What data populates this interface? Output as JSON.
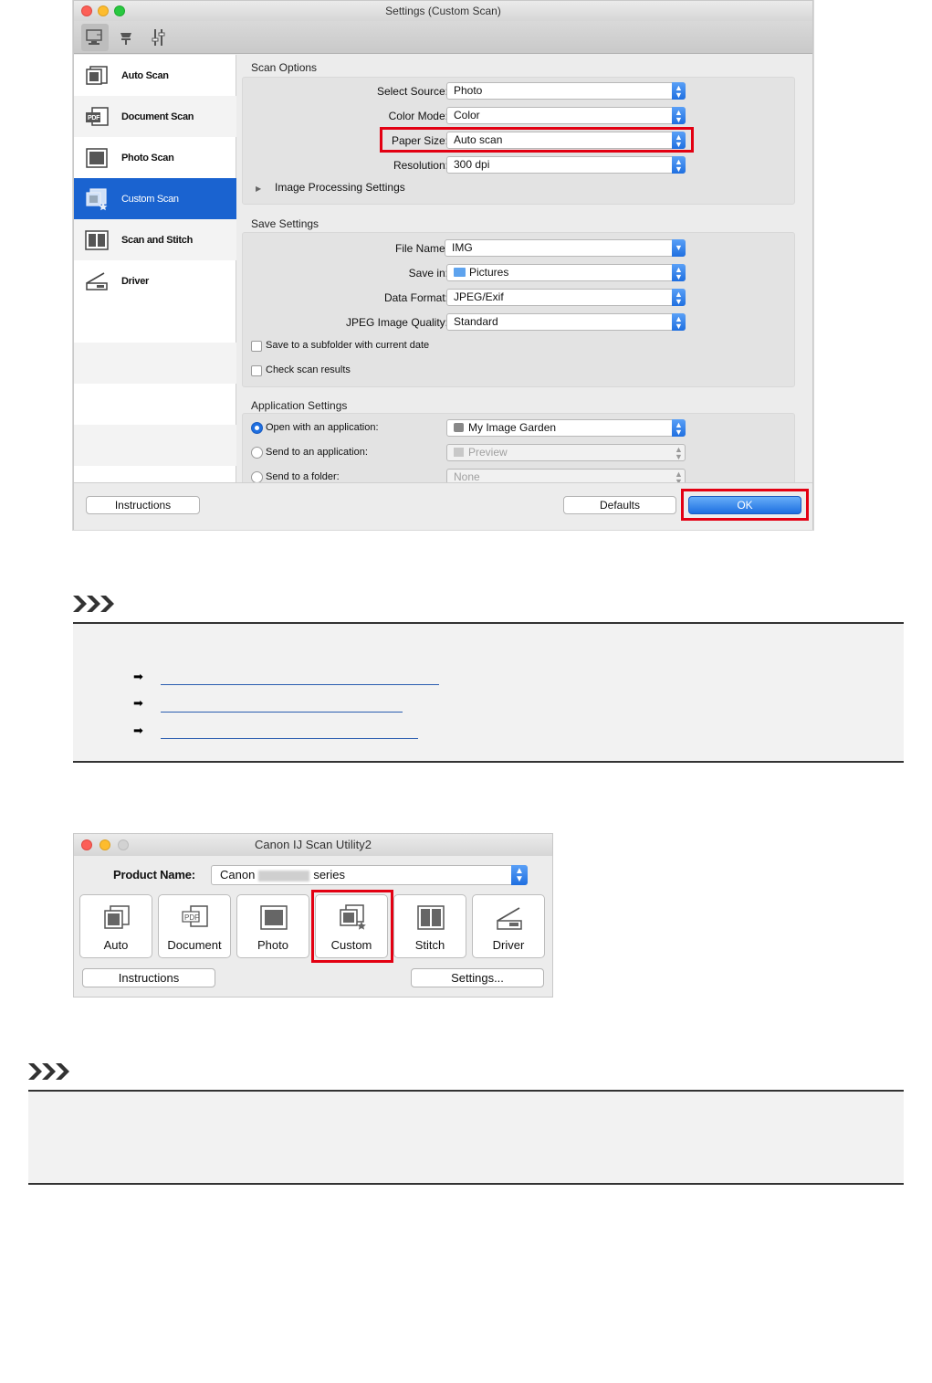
{
  "settings_window": {
    "title": "Settings (Custom Scan)",
    "toolbar_icons": [
      "scan-from-computer-icon",
      "scan-from-panel-icon",
      "general-settings-icon"
    ],
    "sidebar": [
      {
        "label": "Auto Scan",
        "icon": "auto-scan-icon"
      },
      {
        "label": "Document Scan",
        "icon": "document-scan-icon"
      },
      {
        "label": "Photo Scan",
        "icon": "photo-scan-icon"
      },
      {
        "label": "Custom Scan",
        "icon": "custom-scan-icon",
        "selected": true
      },
      {
        "label": "Scan and Stitch",
        "icon": "scan-stitch-icon"
      },
      {
        "label": "Driver",
        "icon": "driver-icon"
      }
    ],
    "scan_options": {
      "heading": "Scan Options",
      "select_source": {
        "label": "Select Source:",
        "value": "Photo"
      },
      "color_mode": {
        "label": "Color Mode:",
        "value": "Color"
      },
      "paper_size": {
        "label": "Paper Size:",
        "value": "Auto scan"
      },
      "resolution": {
        "label": "Resolution:",
        "value": "300 dpi"
      },
      "image_processing": "Image Processing Settings"
    },
    "save_settings": {
      "heading": "Save Settings",
      "file_name": {
        "label": "File Name:",
        "value": "IMG"
      },
      "save_in": {
        "label": "Save in:",
        "value": "Pictures"
      },
      "data_format": {
        "label": "Data Format:",
        "value": "JPEG/Exif"
      },
      "jpeg_quality": {
        "label": "JPEG Image Quality:",
        "value": "Standard"
      },
      "subfolder_check": "Save to a subfolder with current date",
      "check_results": "Check scan results"
    },
    "application_settings": {
      "heading": "Application Settings",
      "open_with": {
        "label": "Open with an application:",
        "value": "My Image Garden"
      },
      "send_to_app": {
        "label": "Send to an application:",
        "value": "Preview"
      },
      "send_to_folder": {
        "label": "Send to a folder:",
        "value": "None"
      }
    },
    "buttons": {
      "instructions": "Instructions",
      "defaults": "Defaults",
      "ok": "OK"
    },
    "colors": {
      "accent": "#1a63d0",
      "highlight": "#e30012"
    }
  },
  "scan_utility_window": {
    "title": "Canon IJ Scan Utility2",
    "product_label": "Product Name:",
    "product_prefix": "Canon",
    "product_suffix": "series",
    "tiles": [
      {
        "label": "Auto",
        "icon": "auto-scan-icon"
      },
      {
        "label": "Document",
        "icon": "pdf-document-icon"
      },
      {
        "label": "Photo",
        "icon": "photo-icon"
      },
      {
        "label": "Custom",
        "icon": "custom-scan-icon"
      },
      {
        "label": "Stitch",
        "icon": "stitch-icon"
      },
      {
        "label": "Driver",
        "icon": "driver-icon"
      }
    ],
    "buttons": {
      "instructions": "Instructions",
      "settings": "Settings..."
    }
  }
}
